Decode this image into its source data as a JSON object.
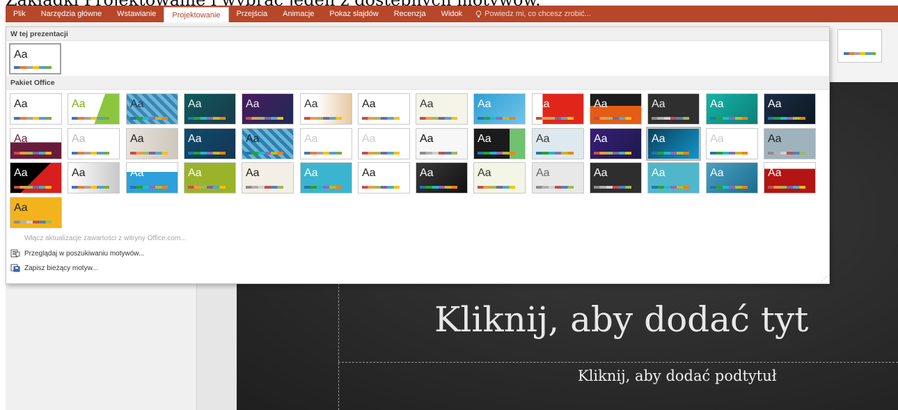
{
  "caption": "Zakładki Projektowanie i wybrać jeden z dostępnych motywów.",
  "ribbon": {
    "tabs": [
      {
        "label": "Plik",
        "active": false
      },
      {
        "label": "Narzędzia główne",
        "active": false
      },
      {
        "label": "Wstawianie",
        "active": false
      },
      {
        "label": "Projektowanie",
        "active": true
      },
      {
        "label": "Przejścia",
        "active": false
      },
      {
        "label": "Animacje",
        "active": false
      },
      {
        "label": "Pokaz slajdów",
        "active": false
      },
      {
        "label": "Recenzja",
        "active": false
      },
      {
        "label": "Widok",
        "active": false
      }
    ],
    "tell_me": "Powiedz mi, co chcesz zrobić...",
    "tell_me_icon": "lightbulb-icon",
    "accent": "#b7472a"
  },
  "gallery": {
    "section_current": "W tej prezentacji",
    "section_office": "Pakiet Office",
    "theme_label": "Aa",
    "enable_updates": "Włącz aktualizacje zawartości z witryny Office.com...",
    "browse_themes": "Przeglądaj w poszukiwaniu motywów...",
    "save_theme": "Zapisz bieżący motyw...",
    "browse_icon": "browse-themes-icon",
    "save_icon": "save-theme-icon"
  },
  "slide": {
    "title_placeholder": "Kliknij, aby dodać tyt",
    "subtitle_placeholder": "Kliknij, aby dodać podtytuł",
    "background": "#2b2b2b"
  }
}
